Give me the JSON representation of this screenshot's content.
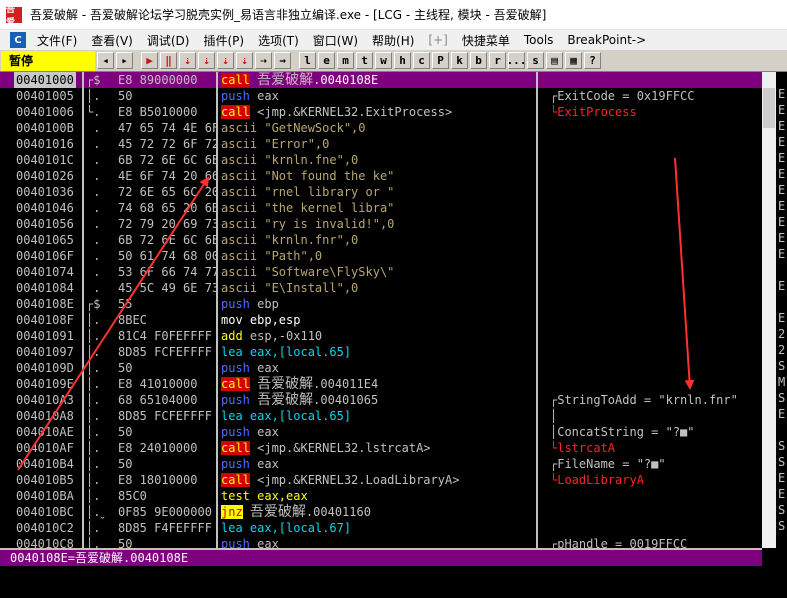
{
  "window": {
    "logo_text": "吾爱",
    "title": "吾爱破解 - 吾爱破解论坛学习脱壳实例_易语言非独立编译.exe - [LCG - 主线程, 模块 - 吾爱破解]"
  },
  "menu": {
    "app_icon": "C",
    "items": [
      "文件(F)",
      "查看(V)",
      "调试(D)",
      "插件(P)",
      "选项(T)",
      "窗口(W)",
      "帮助(H)",
      "[+]",
      "快捷菜单",
      "Tools",
      "BreakPoint->"
    ]
  },
  "toolbar": {
    "status": "暂停",
    "buttons": [
      "◂",
      "▸",
      "▶",
      "‖",
      "⇣",
      "⇣",
      "⇣",
      "⇣",
      "⇢",
      "→",
      "l",
      "e",
      "m",
      "t",
      "w",
      "h",
      "c",
      "P",
      "k",
      "b",
      "r",
      "...",
      "s",
      "▤",
      "▦",
      "?"
    ]
  },
  "disasm": {
    "rows": [
      {
        "addr": "00401000",
        "flag": "┌$",
        "hex": "E8 89000000",
        "parts": [
          {
            "k": "call",
            "t": "call"
          },
          {
            "t": " "
          },
          {
            "t": "吾爱破解",
            "cjk": true
          },
          {
            "t": ".0040108E"
          }
        ],
        "cm": ""
      },
      {
        "addr": "00401005",
        "flag": "│.",
        "hex": "50",
        "parts": [
          {
            "k": "push",
            "t": "push"
          },
          {
            "t": " eax"
          }
        ],
        "cm": "┌ExitCode = 0x19FFCC"
      },
      {
        "addr": "00401006",
        "flag": "└.",
        "hex": "E8 B5010000",
        "parts": [
          {
            "k": "call",
            "t": "call"
          },
          {
            "t": " <jmp.&KERNEL32.ExitProcess>"
          }
        ],
        "cm": "└ExitProcess",
        "cmred": true
      },
      {
        "addr": "0040100B",
        "flag": " .",
        "hex": "47 65 74 4E 6F",
        "parts": [
          {
            "k": "ascii",
            "t": "ascii \"GetNewSock\",0"
          }
        ],
        "cm": ""
      },
      {
        "addr": "00401016",
        "flag": " .",
        "hex": "45 72 72 6F 72",
        "parts": [
          {
            "k": "ascii",
            "t": "ascii \"Error\",0"
          }
        ],
        "cm": ""
      },
      {
        "addr": "0040101C",
        "flag": " .",
        "hex": "6B 72 6E 6C 6E",
        "parts": [
          {
            "k": "ascii",
            "t": "ascii \"krnln.fne\",0"
          }
        ],
        "cm": ""
      },
      {
        "addr": "00401026",
        "flag": " .",
        "hex": "4E 6F 74 20 66",
        "parts": [
          {
            "k": "ascii",
            "t": "ascii \"Not found the ke\""
          }
        ],
        "cm": ""
      },
      {
        "addr": "00401036",
        "flag": " .",
        "hex": "72 6E 65 6C 20",
        "parts": [
          {
            "k": "ascii",
            "t": "ascii \"rnel library or \""
          }
        ],
        "cm": ""
      },
      {
        "addr": "00401046",
        "flag": " .",
        "hex": "74 68 65 20 6B",
        "parts": [
          {
            "k": "ascii",
            "t": "ascii \"the kernel libra\""
          }
        ],
        "cm": ""
      },
      {
        "addr": "00401056",
        "flag": " .",
        "hex": "72 79 20 69 73",
        "parts": [
          {
            "k": "ascii",
            "t": "ascii \"ry is invalid!\",0"
          }
        ],
        "cm": ""
      },
      {
        "addr": "00401065",
        "flag": " .",
        "hex": "6B 72 6E 6C 6E",
        "parts": [
          {
            "k": "ascii",
            "t": "ascii \"krnln.fnr\",0"
          }
        ],
        "cm": ""
      },
      {
        "addr": "0040106F",
        "flag": " .",
        "hex": "50 61 74 68 00",
        "parts": [
          {
            "k": "ascii",
            "t": "ascii \"Path\",0"
          }
        ],
        "cm": ""
      },
      {
        "addr": "00401074",
        "flag": " .",
        "hex": "53 6F 66 74 77",
        "parts": [
          {
            "k": "ascii",
            "t": "ascii \"Software\\FlySky\\\""
          }
        ],
        "cm": ""
      },
      {
        "addr": "00401084",
        "flag": " .",
        "hex": "45 5C 49 6E 73",
        "parts": [
          {
            "k": "ascii",
            "t": "ascii \"E\\Install\",0"
          }
        ],
        "cm": ""
      },
      {
        "addr": "0040108E",
        "flag": "┌$",
        "hex": "55",
        "parts": [
          {
            "k": "push",
            "t": "push"
          },
          {
            "t": " ebp"
          }
        ],
        "cm": ""
      },
      {
        "addr": "0040108F",
        "flag": "│.",
        "hex": "8BEC",
        "parts": [
          {
            "k": "mov",
            "t": "mov ebp,esp"
          }
        ],
        "cm": ""
      },
      {
        "addr": "00401091",
        "flag": "│.",
        "hex": "81C4 F0FEFFFF",
        "parts": [
          {
            "k": "add",
            "t": "add"
          },
          {
            "t": " esp,-0x110"
          }
        ],
        "cm": ""
      },
      {
        "addr": "00401097",
        "flag": "│.",
        "hex": "8D85 FCFEFFFF",
        "parts": [
          {
            "k": "lea",
            "t": "lea eax,[local.65]"
          }
        ],
        "cm": ""
      },
      {
        "addr": "0040109D",
        "flag": "│.",
        "hex": "50",
        "parts": [
          {
            "k": "push",
            "t": "push"
          },
          {
            "t": " eax"
          }
        ],
        "cm": ""
      },
      {
        "addr": "0040109E",
        "flag": "│.",
        "hex": "E8 41010000",
        "parts": [
          {
            "k": "call",
            "t": "call"
          },
          {
            "t": " "
          },
          {
            "t": "吾爱破解",
            "cjk": true
          },
          {
            "t": ".004011E4"
          }
        ],
        "cm": ""
      },
      {
        "addr": "004010A3",
        "flag": "│.",
        "hex": "68 65104000",
        "parts": [
          {
            "k": "push",
            "t": "push"
          },
          {
            "t": " "
          },
          {
            "t": "吾爱破解",
            "cjk": true
          },
          {
            "t": ".00401065"
          }
        ],
        "cm": "┌StringToAdd = \"krnln.fnr\""
      },
      {
        "addr": "004010A8",
        "flag": "│.",
        "hex": "8D85 FCFEFFFF",
        "parts": [
          {
            "k": "lea",
            "t": "lea eax,[local.65]"
          }
        ],
        "cm": "│"
      },
      {
        "addr": "004010AE",
        "flag": "│.",
        "hex": "50",
        "parts": [
          {
            "k": "push",
            "t": "push"
          },
          {
            "t": " eax"
          }
        ],
        "cm": "│ConcatString = \"?■\""
      },
      {
        "addr": "004010AF",
        "flag": "│.",
        "hex": "E8 24010000",
        "parts": [
          {
            "k": "call",
            "t": "call"
          },
          {
            "t": " <jmp.&KERNEL32.lstrcatA>"
          }
        ],
        "cm": "└lstrcatA",
        "cmred": true
      },
      {
        "addr": "004010B4",
        "flag": "│.",
        "hex": "50",
        "parts": [
          {
            "k": "push",
            "t": "push"
          },
          {
            "t": " eax"
          }
        ],
        "cm": "┌FileName = \"?■\""
      },
      {
        "addr": "004010B5",
        "flag": "│.",
        "hex": "E8 18010000",
        "parts": [
          {
            "k": "call",
            "t": "call"
          },
          {
            "t": " <jmp.&KERNEL32.LoadLibraryA>"
          }
        ],
        "cm": "└LoadLibraryA",
        "cmred": true
      },
      {
        "addr": "004010BA",
        "flag": "│.",
        "hex": "85C0",
        "parts": [
          {
            "k": "test",
            "t": "test eax,eax"
          }
        ],
        "cm": ""
      },
      {
        "addr": "004010BC",
        "flag": "│.ˬ",
        "hex": "0F85 9E000000",
        "parts": [
          {
            "k": "jnz",
            "t": "jnz"
          },
          {
            "t": " "
          },
          {
            "t": "吾爱破解",
            "cjk": true
          },
          {
            "t": ".00401160"
          }
        ],
        "cm": ""
      },
      {
        "addr": "004010C2",
        "flag": "│.",
        "hex": "8D85 F4FEFFFF",
        "parts": [
          {
            "k": "lea",
            "t": "lea eax,[local.67]"
          }
        ],
        "cm": ""
      },
      {
        "addr": "004010C8",
        "flag": "│.",
        "hex": "50",
        "parts": [
          {
            "k": "push",
            "t": "push"
          },
          {
            "t": " eax"
          }
        ],
        "cm": "┌pHandle = 0019FFCC"
      }
    ]
  },
  "side_letters": "E\nE\nE\nE\nE\nE\nE\nE\nE\nE\nE\n \nE\n \nE\n2\n2\nS\nM\nS\nE\n \nS\nS\nE\nE\nS\nS",
  "info_text": "0040108E=吾爱破解.0040108E"
}
